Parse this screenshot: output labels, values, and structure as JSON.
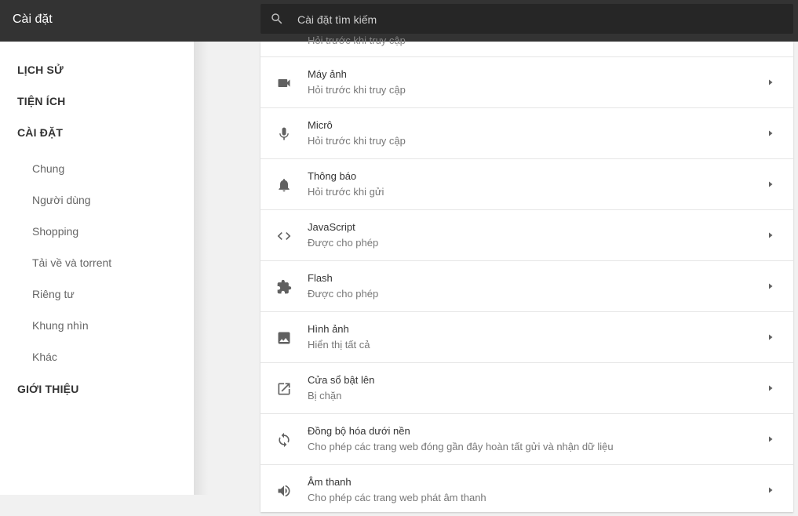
{
  "header": {
    "title": "Cài đặt"
  },
  "search": {
    "placeholder": "Cài đặt tìm kiếm"
  },
  "sidebar": {
    "sections": [
      "LỊCH SỬ",
      "TIỆN ÍCH",
      "CÀI ĐẶT",
      "GIỚI THIỆU"
    ],
    "settings_items": [
      "Chung",
      "Người dùng",
      "Shopping",
      "Tải về và torrent",
      "Riêng tư",
      "Khung nhìn",
      "Khác"
    ]
  },
  "content": {
    "partial_text": "Hỏi trước khi truy cập",
    "rows": [
      {
        "title": "Máy ảnh",
        "subtitle": "Hỏi trước khi truy cập",
        "icon": "camera-icon"
      },
      {
        "title": "Micrô",
        "subtitle": "Hỏi trước khi truy cập",
        "icon": "microphone-icon"
      },
      {
        "title": "Thông báo",
        "subtitle": "Hỏi trước khi gửi",
        "icon": "bell-icon"
      },
      {
        "title": "JavaScript",
        "subtitle": "Được cho phép",
        "icon": "code-icon"
      },
      {
        "title": "Flash",
        "subtitle": "Được cho phép",
        "icon": "puzzle-icon"
      },
      {
        "title": "Hình ảnh",
        "subtitle": "Hiển thị tất cả",
        "icon": "image-icon"
      },
      {
        "title": "Cửa sổ bật lên",
        "subtitle": "Bị chặn",
        "icon": "open-in-new-icon"
      },
      {
        "title": "Đồng bộ hóa dưới nền",
        "subtitle": "Cho phép các trang web đóng gần đây hoàn tất gửi và nhận dữ liệu",
        "icon": "sync-icon"
      },
      {
        "title": "Âm thanh",
        "subtitle": "Cho phép các trang web phát âm thanh",
        "icon": "volume-icon"
      }
    ]
  },
  "colors": {
    "header_bg": "#333333",
    "search_bg": "#262626",
    "icon": "#616161"
  }
}
